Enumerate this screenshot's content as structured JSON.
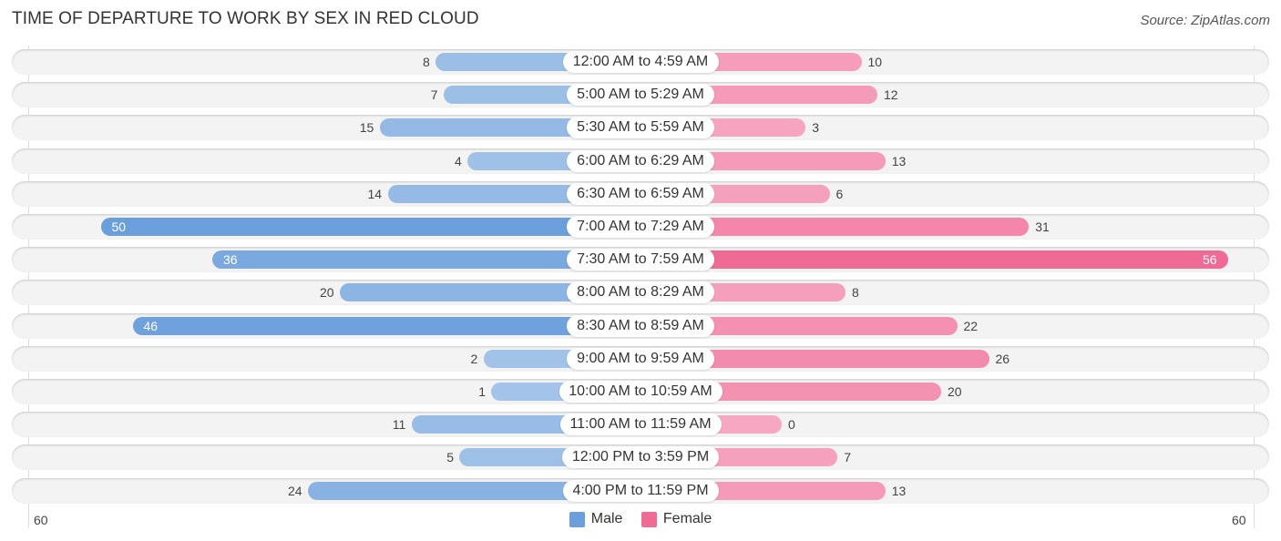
{
  "title": "TIME OF DEPARTURE TO WORK BY SEX IN RED CLOUD",
  "source": "Source: ZipAtlas.com",
  "colors": {
    "male_light": "#a4c4e8",
    "male_dark": "#6a9fdc",
    "female_light": "#f6a8c2",
    "female_dark": "#f06a96"
  },
  "chart_data": {
    "type": "bar",
    "orientation": "horizontal-diverging",
    "title": "TIME OF DEPARTURE TO WORK BY SEX IN RED CLOUD",
    "categories": [
      "12:00 AM to 4:59 AM",
      "5:00 AM to 5:29 AM",
      "5:30 AM to 5:59 AM",
      "6:00 AM to 6:29 AM",
      "6:30 AM to 6:59 AM",
      "7:00 AM to 7:29 AM",
      "7:30 AM to 7:59 AM",
      "8:00 AM to 8:29 AM",
      "8:30 AM to 8:59 AM",
      "9:00 AM to 9:59 AM",
      "10:00 AM to 10:59 AM",
      "11:00 AM to 11:59 AM",
      "12:00 PM to 3:59 PM",
      "4:00 PM to 11:59 PM"
    ],
    "series": [
      {
        "name": "Male",
        "values": [
          8,
          7,
          15,
          4,
          14,
          50,
          36,
          20,
          46,
          2,
          1,
          11,
          5,
          24
        ]
      },
      {
        "name": "Female",
        "values": [
          10,
          12,
          3,
          13,
          6,
          31,
          56,
          8,
          22,
          26,
          20,
          0,
          7,
          13
        ]
      }
    ],
    "axis_range": [
      60,
      60
    ],
    "axis_tick_labels": {
      "left": "60",
      "right": "60"
    },
    "legend": [
      "Male",
      "Female"
    ],
    "legend_position": "bottom-center"
  }
}
